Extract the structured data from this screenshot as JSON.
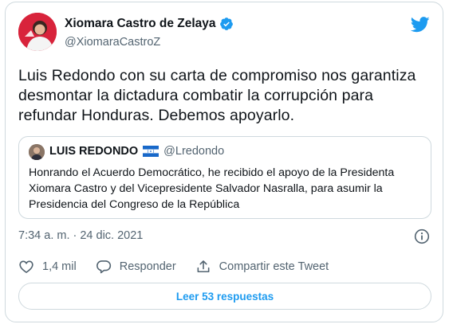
{
  "author": {
    "name": "Xiomara Castro de Zelaya",
    "handle": "@XiomaraCastroZ",
    "verified": true
  },
  "tweet": {
    "text_line1": "Luis Redondo con su carta de compromiso nos garantiza",
    "text_line2": "desmontar la dictadura combatir la corrupción para",
    "text_line3": "refundar Honduras. Debemos apoyarlo."
  },
  "quoted_tweet": {
    "name": "LUIS REDONDO",
    "handle": "@Lredondo",
    "flag_icon": "honduras-flag-icon",
    "text_line1": "Honrando el Acuerdo Democrático, he recibido el apoyo de la Presidenta",
    "text_line2": "Xiomara Castro y del Vicepresidente Salvador Nasralla, para asumir la",
    "text_line3": "Presidencia del Congreso de la República"
  },
  "timestamp": "7:34 a. m. · 24 dic. 2021",
  "actions": {
    "like_count": "1,4 mil",
    "reply_label": "Responder",
    "share_label": "Compartir este Tweet"
  },
  "read_replies_label": "Leer 53 respuestas",
  "colors": {
    "brand": "#1d9bf0",
    "text": "#0f1419",
    "muted": "#536471",
    "border": "#cfd9de",
    "avatar_bg": "#d8233b"
  }
}
